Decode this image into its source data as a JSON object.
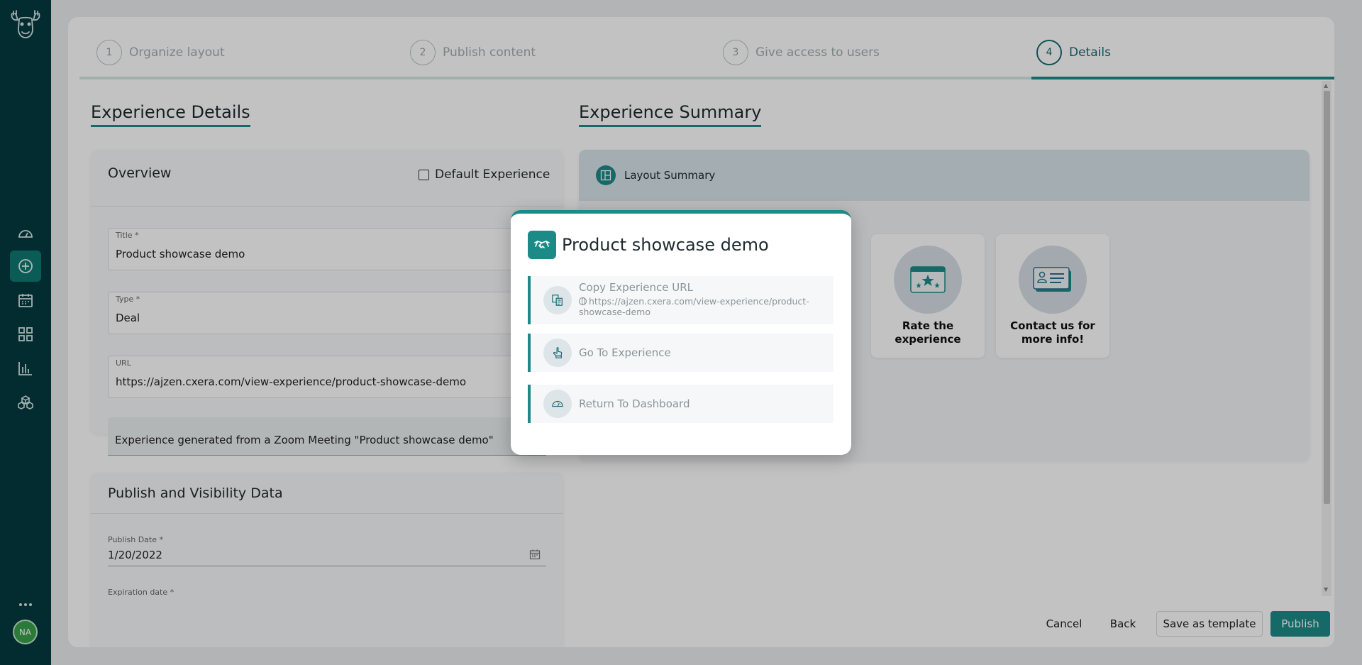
{
  "sidebar": {
    "avatar_initials": "NA",
    "items": [
      {
        "name": "dashboard"
      },
      {
        "name": "create-experience"
      },
      {
        "name": "calendar"
      },
      {
        "name": "apps"
      },
      {
        "name": "analytics"
      },
      {
        "name": "integrations"
      },
      {
        "name": "more"
      }
    ]
  },
  "stepper": {
    "steps": [
      {
        "num": "1",
        "label": "Organize layout"
      },
      {
        "num": "2",
        "label": "Publish content"
      },
      {
        "num": "3",
        "label": "Give access to users"
      },
      {
        "num": "4",
        "label": "Details"
      }
    ]
  },
  "details": {
    "heading": "Experience Details",
    "overview": {
      "title": "Overview",
      "default_label": "Default Experience",
      "fields": {
        "title_label": "Title *",
        "title_value": "Product showcase demo",
        "type_label": "Type *",
        "type_value": "Deal",
        "url_label": "URL",
        "url_value": "https://ajzen.cxera.com/view-experience/product-showcase-demo",
        "description_value": "Experience generated from a Zoom Meeting \"Product showcase demo\""
      }
    },
    "publish": {
      "title": "Publish and Visibility Data",
      "publish_date_label": "Publish Date *",
      "publish_date_value": "1/20/2022",
      "expiration_label": "Expiration date *"
    }
  },
  "summary": {
    "heading": "Experience Summary",
    "layout_label": "Layout Summary",
    "tiles": [
      {
        "label": "Rate the experience"
      },
      {
        "label": "Contact us for more info!"
      }
    ]
  },
  "footer": {
    "cancel": "Cancel",
    "back": "Back",
    "save_template": "Save as template",
    "publish": "Publish"
  },
  "modal": {
    "title": "Product showcase demo",
    "copy_label": "Copy Experience URL",
    "copy_url": "https://ajzen.cxera.com/view-experience/product-showcase-demo",
    "go_label": "Go To Experience",
    "dashboard_label": "Return To Dashboard"
  },
  "colors": {
    "sidebar": "#053a41",
    "accent": "#1c8a87",
    "active_nav": "#0f7a72",
    "avatar": "#39a14b"
  }
}
